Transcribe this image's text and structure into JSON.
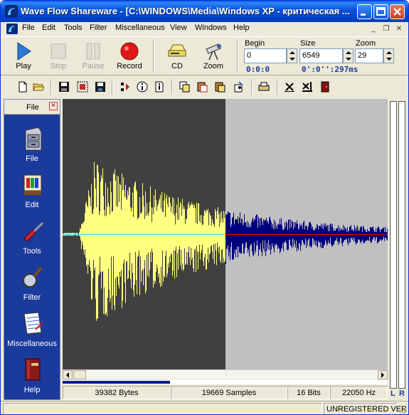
{
  "window": {
    "title": "Wave Flow Shareware - [C:\\WINDOWS\\Media\\Windows XP - критическая ..."
  },
  "menu": {
    "items": [
      "File",
      "Edit",
      "Tools",
      "Filter",
      "Miscellaneous",
      "View",
      "Windows",
      "Help"
    ]
  },
  "toolbar": {
    "play_label": "Play",
    "stop_label": "Stop",
    "pause_label": "Pause",
    "record_label": "Record",
    "cd_label": "CD",
    "zoom_label": "Zoom"
  },
  "fields": {
    "begin_label": "Begin",
    "begin_value": "0",
    "begin_time": "0:0:0",
    "size_label": "Size",
    "size_value": "6549",
    "size_time": "0':0'':297ms",
    "zoom_label": "Zoom",
    "zoom_value": "29"
  },
  "sidebar": {
    "title": "File",
    "items": [
      {
        "label": "File",
        "icon": "file-cabinet-icon"
      },
      {
        "label": "Edit",
        "icon": "paint-palette-icon"
      },
      {
        "label": "Tools",
        "icon": "screwdriver-icon"
      },
      {
        "label": "Filter",
        "icon": "magnifier-icon"
      },
      {
        "label": "Miscellaneous",
        "icon": "notepad-icon"
      },
      {
        "label": "Help",
        "icon": "book-icon"
      }
    ]
  },
  "waveform": {
    "selected_color": "#ffff80",
    "wave_color": "#00007f",
    "selected_bg": "#404040",
    "unselected_bg": "#c0c0c0",
    "axis_selected_color": "#55d4d4",
    "axis_color": "#ff0000",
    "selection_fraction": 0.5
  },
  "playback_progress": 0.33,
  "info": {
    "bytes": "39382 Bytes",
    "samples": "19669 Samples",
    "bits": "16 Bits",
    "rate": "22050 Hz"
  },
  "vu": {
    "left_label": "L",
    "right_label": "R"
  },
  "status": {
    "registration": "UNREGISTERED VER"
  }
}
